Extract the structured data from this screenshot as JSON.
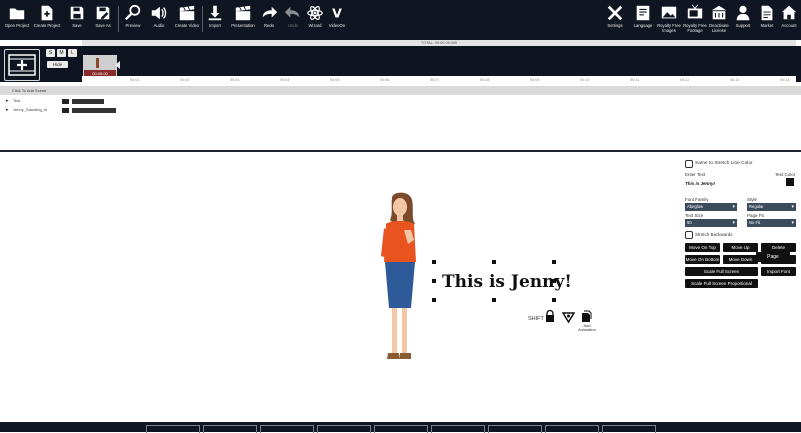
{
  "toolbar": {
    "left_buttons": [
      {
        "label": "Open Project",
        "icon": "folder-icon"
      },
      {
        "label": "Create Project",
        "icon": "new-file-icon"
      },
      {
        "label": "Save",
        "icon": "save-icon"
      },
      {
        "label": "Save As",
        "icon": "save-as-icon"
      },
      {
        "label": "Preview",
        "icon": "magnifier-icon"
      },
      {
        "label": "Audio",
        "icon": "speaker-icon"
      },
      {
        "label": "Create Video",
        "icon": "clapperboard-icon"
      },
      {
        "label": "Import",
        "icon": "download-icon"
      },
      {
        "label": "Presentation",
        "icon": "clapperboard-icon"
      },
      {
        "label": "Redo",
        "icon": "redo-icon"
      },
      {
        "label": "Undo",
        "icon": "undo-icon"
      },
      {
        "label": "Wizard",
        "icon": "atom-icon"
      },
      {
        "label": "VideoOn",
        "icon": "v-icon"
      }
    ],
    "right_buttons": [
      {
        "label": "Settings",
        "icon": "tools-icon"
      },
      {
        "label": "Language",
        "icon": "language-icon"
      },
      {
        "label": "Royalty Free Images",
        "icon": "image-icon"
      },
      {
        "label": "Royalty Free Footage",
        "icon": "tv-icon"
      },
      {
        "label": "Deactivate License",
        "icon": "building-icon"
      },
      {
        "label": "Support",
        "icon": "support-agent-icon"
      },
      {
        "label": "Market",
        "icon": "document-icon"
      },
      {
        "label": "Account",
        "icon": "home-icon"
      }
    ]
  },
  "timeline": {
    "small_buttons": [
      "S",
      "M",
      "L"
    ],
    "hide_label": "Hide",
    "ruler_title": "TOTAL: 00:00:05:000",
    "clip_caption": "00:05.00",
    "ticks": [
      "00:01",
      "00:02",
      "00:03",
      "00:04",
      "00:05",
      "00:06",
      "00:07",
      "00:08",
      "00:09",
      "00:10",
      "00:11",
      "00:12",
      "00:13",
      "00:14"
    ],
    "section_label": "Click To Add Scene",
    "tracks": [
      {
        "name": "Text"
      },
      {
        "name": "Jenny_Standing_hi"
      }
    ]
  },
  "stage": {
    "text": "This is Jenny!",
    "shift_label": "SHIFT",
    "animation_label": "Add Animation"
  },
  "panel": {
    "same_color_label": "Same to Stretch Line Color",
    "enter_text_label": "Enter Text",
    "text_color_label": "Text Color",
    "text_value": "This is Jenny!",
    "font_family_label": "Font Family",
    "font_family_value": "Abeglow",
    "style_label": "Style",
    "style_value": "Regular",
    "text_size_label": "Text Size",
    "text_size_value": "60",
    "page_fit_label": "Page Fit",
    "page_fit_value": "No Fit",
    "stretch_label": "Stretch Backwards",
    "buttons": [
      "Move On Top",
      "Move Up",
      "Delete",
      "Move On Bottom",
      "Move Down",
      "New Scene",
      "Scale Full Screen",
      "Import Font",
      "Scale Full Screen Proportional"
    ]
  },
  "page_button": "Page",
  "colors": {
    "toolbar_bg": "#101621",
    "panel_select": "#3b4a5c",
    "clip_caption": "#8a2a2a"
  }
}
